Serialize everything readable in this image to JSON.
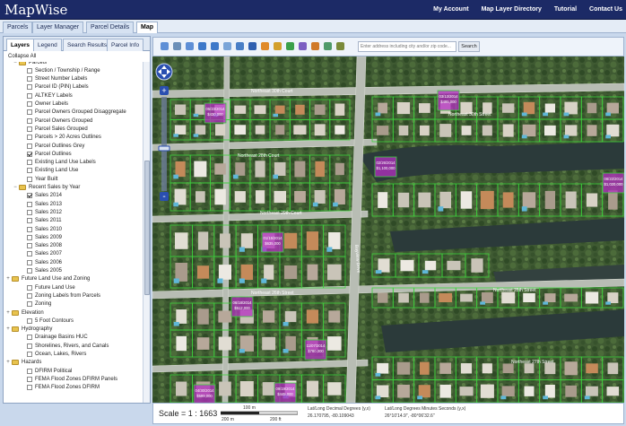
{
  "header": {
    "logo": "MapWise",
    "nav": [
      "My Account",
      "Map Layer Directory",
      "Tutorial",
      "Contact Us"
    ]
  },
  "main_tabs": [
    "Parcels",
    "Layer Manager",
    "Parcel Details",
    "Map"
  ],
  "left_panel": {
    "tabs": [
      "Layers",
      "Legend",
      "Search Results",
      "Parcel Info"
    ],
    "collapse_all": "Collapse All",
    "tree": [
      {
        "label": "Parcels",
        "type": "folder",
        "level": 0,
        "checked": true
      },
      {
        "label": "Section / Township / Range",
        "type": "item",
        "level": 1,
        "checked": false
      },
      {
        "label": "Street Number Labels",
        "type": "item",
        "level": 1,
        "checked": false
      },
      {
        "label": "Parcel ID (PIN) Labels",
        "type": "item",
        "level": 1,
        "checked": false
      },
      {
        "label": "ALTKEY Labels",
        "type": "item",
        "level": 1,
        "checked": false
      },
      {
        "label": "Owner Labels",
        "type": "item",
        "level": 1,
        "checked": false
      },
      {
        "label": "Parcel Owners Grouped Disaggregate",
        "type": "item",
        "level": 1,
        "checked": false
      },
      {
        "label": "Parcel Owners Grouped",
        "type": "item",
        "level": 1,
        "checked": false
      },
      {
        "label": "Parcel Sales Grouped",
        "type": "item",
        "level": 1,
        "checked": false
      },
      {
        "label": "Parcels > 20 Acres Outlines",
        "type": "item",
        "level": 1,
        "checked": false
      },
      {
        "label": "Parcel Outlines Grey",
        "type": "item",
        "level": 1,
        "checked": false
      },
      {
        "label": "Parcel Outlines",
        "type": "item",
        "level": 1,
        "checked": true
      },
      {
        "label": "Existing Land Use Labels",
        "type": "item",
        "level": 1,
        "checked": false
      },
      {
        "label": "Existing Land Use",
        "type": "item",
        "level": 1,
        "checked": false
      },
      {
        "label": "Year Built",
        "type": "item",
        "level": 1,
        "checked": false
      },
      {
        "label": "Recent Sales by Year",
        "type": "folder",
        "level": 0,
        "checked": false
      },
      {
        "label": "Sales 2014",
        "type": "item",
        "level": 1,
        "checked": true
      },
      {
        "label": "Sales 2013",
        "type": "item",
        "level": 1,
        "checked": false
      },
      {
        "label": "Sales 2012",
        "type": "item",
        "level": 1,
        "checked": false
      },
      {
        "label": "Sales 2011",
        "type": "item",
        "level": 1,
        "checked": false
      },
      {
        "label": "Sales 2010",
        "type": "item",
        "level": 1,
        "checked": false
      },
      {
        "label": "Sales 2009",
        "type": "item",
        "level": 1,
        "checked": false
      },
      {
        "label": "Sales 2008",
        "type": "item",
        "level": 1,
        "checked": false
      },
      {
        "label": "Sales 2007",
        "type": "item",
        "level": 1,
        "checked": false
      },
      {
        "label": "Sales 2006",
        "type": "item",
        "level": 1,
        "checked": false
      },
      {
        "label": "Sales 2005",
        "type": "item",
        "level": 1,
        "checked": false
      },
      {
        "label": "Future Land Use and Zoning",
        "type": "folder",
        "level": -1,
        "checked": false
      },
      {
        "label": "Future Land Use",
        "type": "item",
        "level": 1,
        "checked": false
      },
      {
        "label": "Zoning Labels from Parcels",
        "type": "item",
        "level": 1,
        "checked": false
      },
      {
        "label": "Zoning",
        "type": "item",
        "level": 1,
        "checked": false
      },
      {
        "label": "Elevation",
        "type": "folder",
        "level": -1,
        "checked": false
      },
      {
        "label": "5 Foot Contours",
        "type": "item",
        "level": 1,
        "checked": false
      },
      {
        "label": "Hydrography",
        "type": "folder",
        "level": -1,
        "checked": false
      },
      {
        "label": "Drainage Basins HUC",
        "type": "item",
        "level": 1,
        "checked": false
      },
      {
        "label": "Shorelines, Rivers, and Canals",
        "type": "item",
        "level": 1,
        "checked": false
      },
      {
        "label": "Ocean, Lakes, Rivers",
        "type": "item",
        "level": 1,
        "checked": false
      },
      {
        "label": "Hazards",
        "type": "folder",
        "level": -1,
        "checked": false
      },
      {
        "label": "DFIRM Political",
        "type": "item",
        "level": 1,
        "checked": false
      },
      {
        "label": "FEMA Flood Zones DFIRM Panels",
        "type": "item",
        "level": 1,
        "checked": false
      },
      {
        "label": "FEMA Flood Zones DFIRM",
        "type": "item",
        "level": 1,
        "checked": false
      }
    ]
  },
  "map": {
    "search_placeholder": "Enter address including city and/or zip code...",
    "search_button": "Search",
    "street_labels": [
      "Northeast 30th Court",
      "Northeast 30th Street",
      "Northeast 29th Court",
      "Northeast 28th Court",
      "Northeast 28th Street",
      "Northeast 27th Street",
      "Northeast 26th Street",
      "Bayview Drive"
    ],
    "sale_labels": [
      {
        "text1": "05/23/2014",
        "text2": "$430,000"
      },
      {
        "text1": "03/13/2014",
        "text2": "$495,000"
      },
      {
        "text1": "02/26/2014",
        "text2": "$1,100,000"
      },
      {
        "text1": "01/15/2014",
        "text2": "$635,000"
      },
      {
        "text1": "06/18/2014",
        "text2": "$512,000"
      },
      {
        "text1": "11/07/2014",
        "text2": "$780,000"
      },
      {
        "text1": "08/22/2014",
        "text2": "$1,020,000"
      },
      {
        "text1": "04/30/2014",
        "text2": "$599,000"
      },
      {
        "text1": "09/19/2014",
        "text2": "$445,000"
      }
    ],
    "colors": {
      "parcel_outline": "#3cd13c",
      "sale_fill": "#b42fc2",
      "water": "#2b3a3a",
      "road": "#b8bdb4"
    }
  },
  "status_bar": {
    "scale_text": "Scale = 1 : 1663",
    "scale_bar_labels": [
      "200 m",
      "100 m",
      "200 ft"
    ],
    "latlon_label": "Lat/Long Decimal Degrees (y,x)",
    "latlon_value": "26.170795, -80.109043",
    "dms_label": "Lat/Long Degrees Minutes Seconds (y,x)",
    "dms_value": "26°10'14.9\", -80°06'32.6\""
  }
}
